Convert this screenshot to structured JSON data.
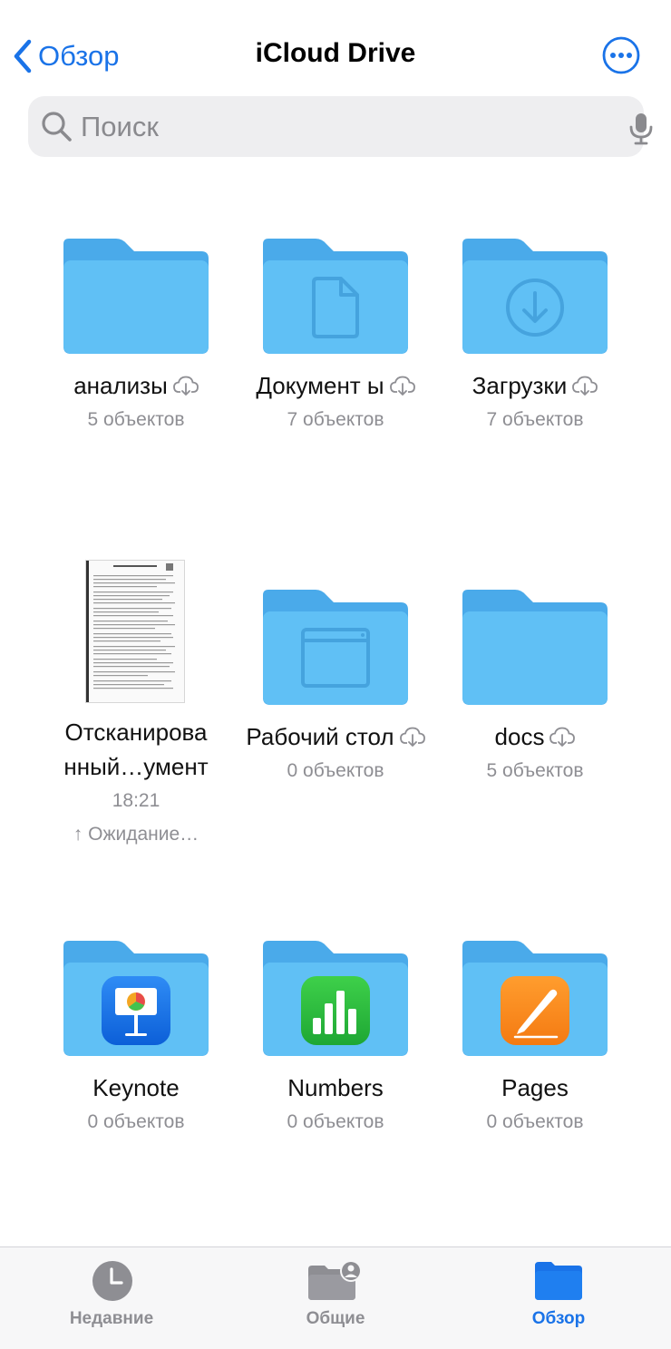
{
  "nav": {
    "back_label": "Обзор",
    "title": "iCloud Drive"
  },
  "search": {
    "placeholder": "Поиск"
  },
  "colors": {
    "accent": "#1a73e8",
    "folder_front": "#60c0f5",
    "folder_back": "#4aaaea",
    "secondary_text": "#8e8e93"
  },
  "items": [
    {
      "name": "анализы",
      "sub": "5 объектов",
      "icon": "folder-icon",
      "cloud": true
    },
    {
      "name": "Документ ы",
      "sub": "7 объектов",
      "icon": "documents-folder-icon",
      "cloud": true
    },
    {
      "name": "Загрузки",
      "sub": "7 объектов",
      "icon": "downloads-folder-icon",
      "cloud": true
    },
    {
      "name": "Отсканирова нный…умент",
      "sub": "18:21",
      "sub2": "↑ Ожидание…",
      "icon": "scanned-document-thumbnail",
      "cloud": false
    },
    {
      "name": "Рабочий стол",
      "sub": "0 объектов",
      "icon": "desktop-folder-icon",
      "cloud": true
    },
    {
      "name": "docs",
      "sub": "5 объектов",
      "icon": "folder-icon",
      "cloud": true
    },
    {
      "name": "Keynote",
      "sub": "0 объектов",
      "icon": "keynote-folder-icon",
      "cloud": false
    },
    {
      "name": "Numbers",
      "sub": "0 объектов",
      "icon": "numbers-folder-icon",
      "cloud": false
    },
    {
      "name": "Pages",
      "sub": "0 объектов",
      "icon": "pages-folder-icon",
      "cloud": false
    }
  ],
  "tabs": [
    {
      "label": "Недавние",
      "icon": "clock-icon",
      "active": false
    },
    {
      "label": "Общие",
      "icon": "shared-folder-icon",
      "active": false
    },
    {
      "label": "Обзор",
      "icon": "browse-folder-icon",
      "active": true
    }
  ]
}
